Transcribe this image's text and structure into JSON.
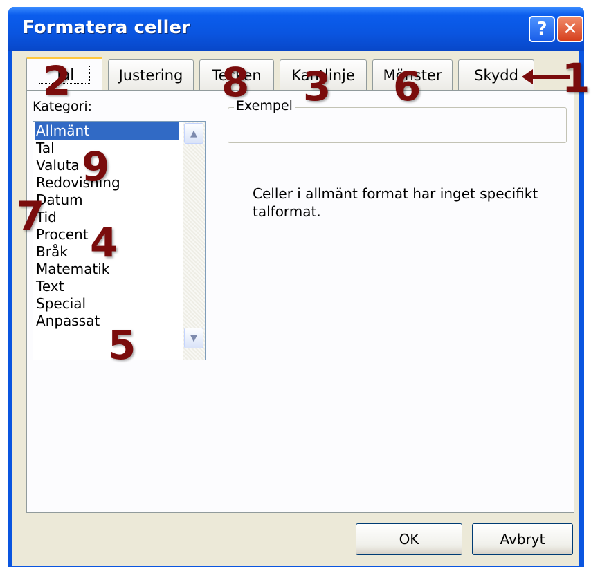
{
  "window": {
    "title": "Formatera celler",
    "help_label": "?",
    "close_label": "✕"
  },
  "tabs": [
    {
      "label": "Tal",
      "active": true
    },
    {
      "label": "Justering"
    },
    {
      "label": "Tecken"
    },
    {
      "label": "Kantlinje"
    },
    {
      "label": "Mönster"
    },
    {
      "label": "Skydd"
    }
  ],
  "category": {
    "label": "Kategori:",
    "items": [
      "Allmänt",
      "Tal",
      "Valuta",
      "Redovisning",
      "Datum",
      "Tid",
      "Procent",
      "Bråk",
      "Matematik",
      "Text",
      "Special",
      "Anpassat"
    ],
    "selected": "Allmänt"
  },
  "example": {
    "label": "Exempel",
    "value": ""
  },
  "description": "Celler i allmänt format har inget specifikt talformat.",
  "buttons": {
    "ok": "OK",
    "cancel": "Avbryt"
  },
  "annotations": [
    "1",
    "2",
    "3",
    "4",
    "5",
    "6",
    "7",
    "8",
    "9"
  ],
  "colors": {
    "title_bar": "#0a55e0",
    "selection": "#316ac5",
    "annotation": "#7a0c0c",
    "tab_accent": "#ffc83c"
  },
  "icons": {
    "help": "help-icon",
    "close": "close-icon",
    "scroll_up": "scroll-up-icon",
    "scroll_down": "scroll-down-icon"
  }
}
